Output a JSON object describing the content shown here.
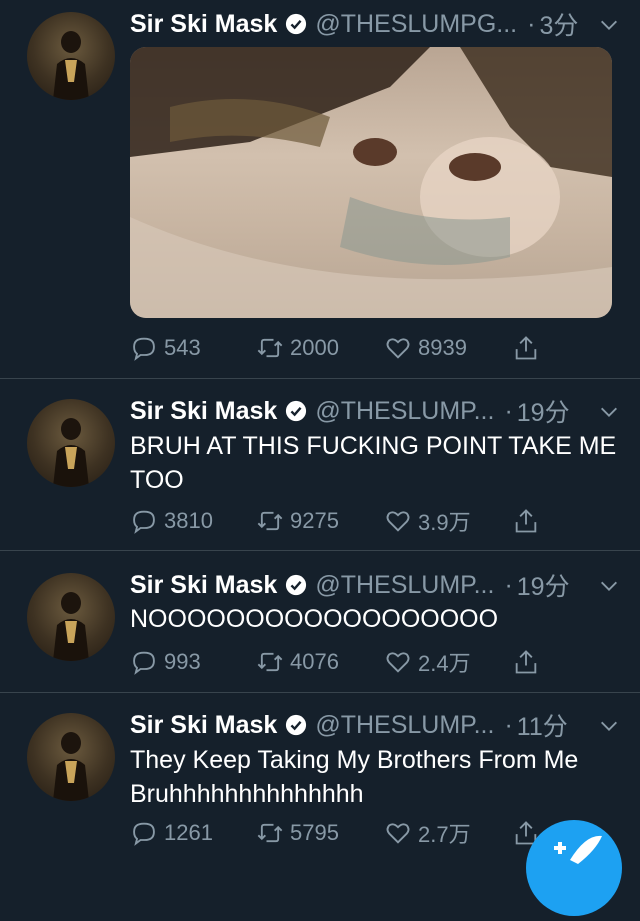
{
  "colors": {
    "background": "#15202b",
    "secondary_text": "#8899a6",
    "divider": "#38444d",
    "accent": "#1da1f2"
  },
  "tweets": [
    {
      "name": "Sir Ski Mask",
      "handle": "@THESLUMPG...",
      "dot": "·",
      "time": "3分",
      "text": "",
      "has_media": true,
      "replies": "543",
      "retweets": "2000",
      "likes": "8939"
    },
    {
      "name": "Sir Ski Mask",
      "handle": "@THESLUMP...",
      "dot": "·",
      "time": "19分",
      "text": "BRUH AT THIS FUCKING POINT TAKE ME TOO",
      "replies": "3810",
      "retweets": "9275",
      "likes": "3.9万"
    },
    {
      "name": "Sir Ski Mask",
      "handle": "@THESLUMP...",
      "dot": "·",
      "time": "19分",
      "text": "NOOOOOOOOOOOOOOOOOO",
      "replies": "993",
      "retweets": "4076",
      "likes": "2.4万"
    },
    {
      "name": "Sir Ski Mask",
      "handle": "@THESLUMP...",
      "dot": "·",
      "time": "11分",
      "text": "They Keep Taking My Brothers From Me Bruhhhhhhhhhhhhhh",
      "replies": "1261",
      "retweets": "5795",
      "likes": "2.7万"
    }
  ],
  "icons": {
    "avatar": "profile-avatar",
    "verified": "verified-badge-icon",
    "chevron": "chevron-down-icon",
    "reply": "reply-bubble-icon",
    "retweet": "retweet-icon",
    "like": "heart-icon",
    "share": "share-icon",
    "compose": "compose-tweet-icon"
  }
}
